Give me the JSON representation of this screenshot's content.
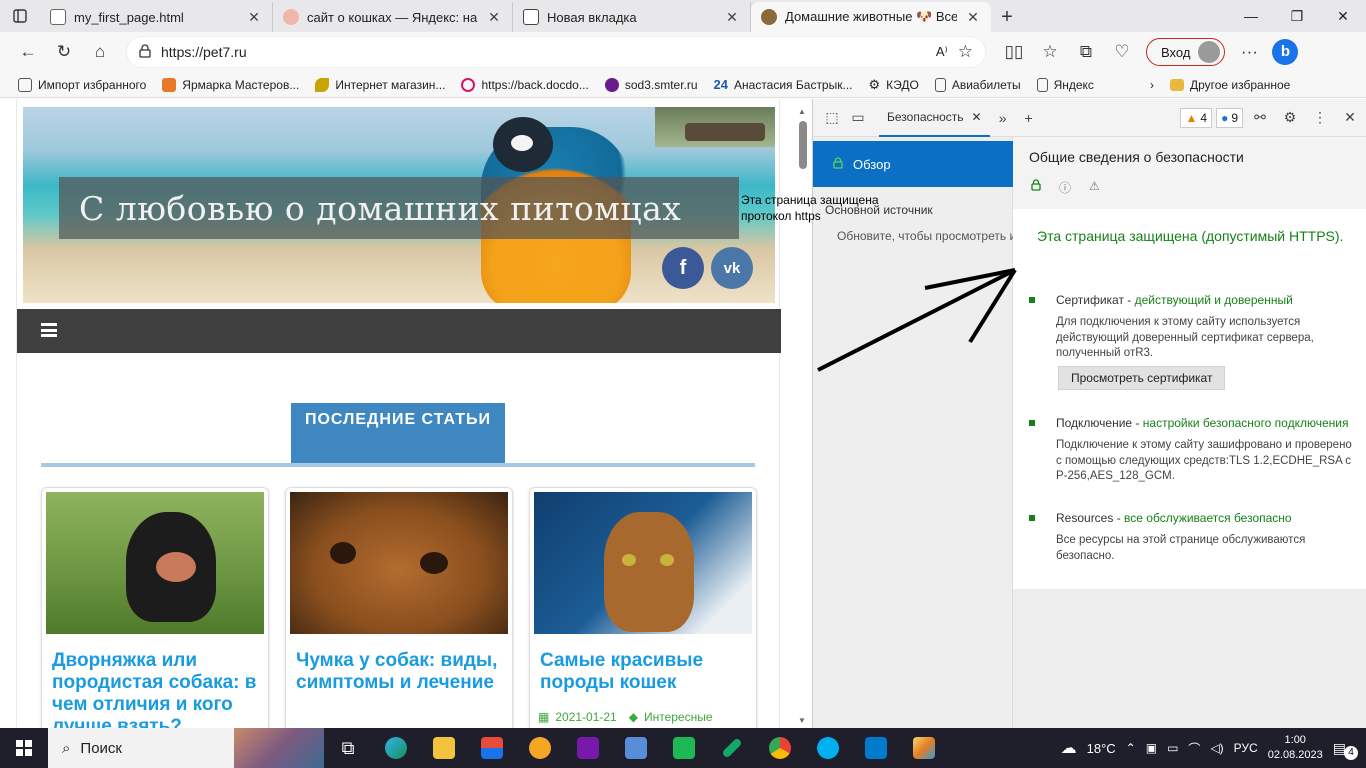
{
  "browser": {
    "tabs": [
      {
        "title": "my_first_page.html",
        "color": "#6b6b6b",
        "active": false
      },
      {
        "title": "сайт о кошках — Яндекс: нашлось",
        "color": "#f0b6ab",
        "active": false
      },
      {
        "title": "Новая вкладка",
        "color": "#444444",
        "active": false
      },
      {
        "title": "Домашние животные 🐶 Все пр",
        "color": "#8a6a3a",
        "active": true
      }
    ],
    "url": "https://pet7.ru",
    "signin_label": "Вход",
    "bookmarks": [
      {
        "label": "Импорт избранного",
        "icon": "import-icon",
        "color": "#555555"
      },
      {
        "label": "Ярмарка Мастеров...",
        "icon": "fair-icon",
        "color": "#e77a2a"
      },
      {
        "label": "Интернет магазин...",
        "icon": "leaf-icon",
        "color": "#c9a400"
      },
      {
        "label": "https://back.docdo...",
        "icon": "plus-icon",
        "color": "#d0186a"
      },
      {
        "label": "sod3.smter.ru",
        "icon": "spinner-icon",
        "color": "#6a1d8a"
      },
      {
        "label": "Анастасия Бастрык...",
        "icon": "24-icon",
        "color": "#1e5aa8"
      },
      {
        "label": "КЭДО",
        "icon": "gear-icon",
        "color": "#333333"
      },
      {
        "label": "Авиабилеты",
        "icon": "page-icon",
        "color": "#555555"
      },
      {
        "label": "Яндекс",
        "icon": "page-icon",
        "color": "#555555"
      }
    ],
    "bookmarks_other": "Другое избранное"
  },
  "site": {
    "banner_title": "С любовью о домашних питомцах",
    "social": {
      "fb": "f",
      "vk": "vk"
    },
    "section_title": "ПОСЛЕДНИЕ СТАТЬИ",
    "cards": [
      {
        "title": "Дворняжка или породистая собака: в чем отличия и кого лучше взять?",
        "date": "",
        "category": ""
      },
      {
        "title": "Чумка у собак: виды, симптомы и лечение",
        "date": "",
        "category": ""
      },
      {
        "title": "Самые красивые породы кошек",
        "date": "2021-01-21",
        "category": "Интересные"
      }
    ]
  },
  "annotation": {
    "note": "Эта страница защищена протокол https"
  },
  "devtools": {
    "tab_label": "Безопасность",
    "warnings": "4",
    "messages": "9",
    "overview_label": "Обзор",
    "main_source": "Основной источник",
    "reload_hint": "Обновите, чтобы просмотреть и",
    "header": "Общие сведения о безопасности",
    "secure_message": "Эта страница защищена (допустимый HTTPS).",
    "items": [
      {
        "name": "Сертификат",
        "status": "действующий и доверенный",
        "text": "Для подключения к этому сайту используется действующий доверенный сертификат сервера, полученный отR3.",
        "button": "Просмотреть сертификат"
      },
      {
        "name": "Подключение",
        "status": "настройки безопасного подключения",
        "text": "Подключение к этому сайту зашифровано и проверено с помощью следующих средств:TLS 1.2,ECDHE_RSA с P-256,AES_128_GCM.",
        "button": ""
      },
      {
        "name": "Resources",
        "status": "все обслуживается безопасно",
        "text": "Все ресурсы на этой странице обслуживаются безопасно.",
        "button": ""
      }
    ]
  },
  "taskbar": {
    "search_label": "Поиск",
    "temperature": "18°C",
    "language": "РУС",
    "time": "1:00",
    "date": "02.08.2023",
    "notifications": "4"
  }
}
